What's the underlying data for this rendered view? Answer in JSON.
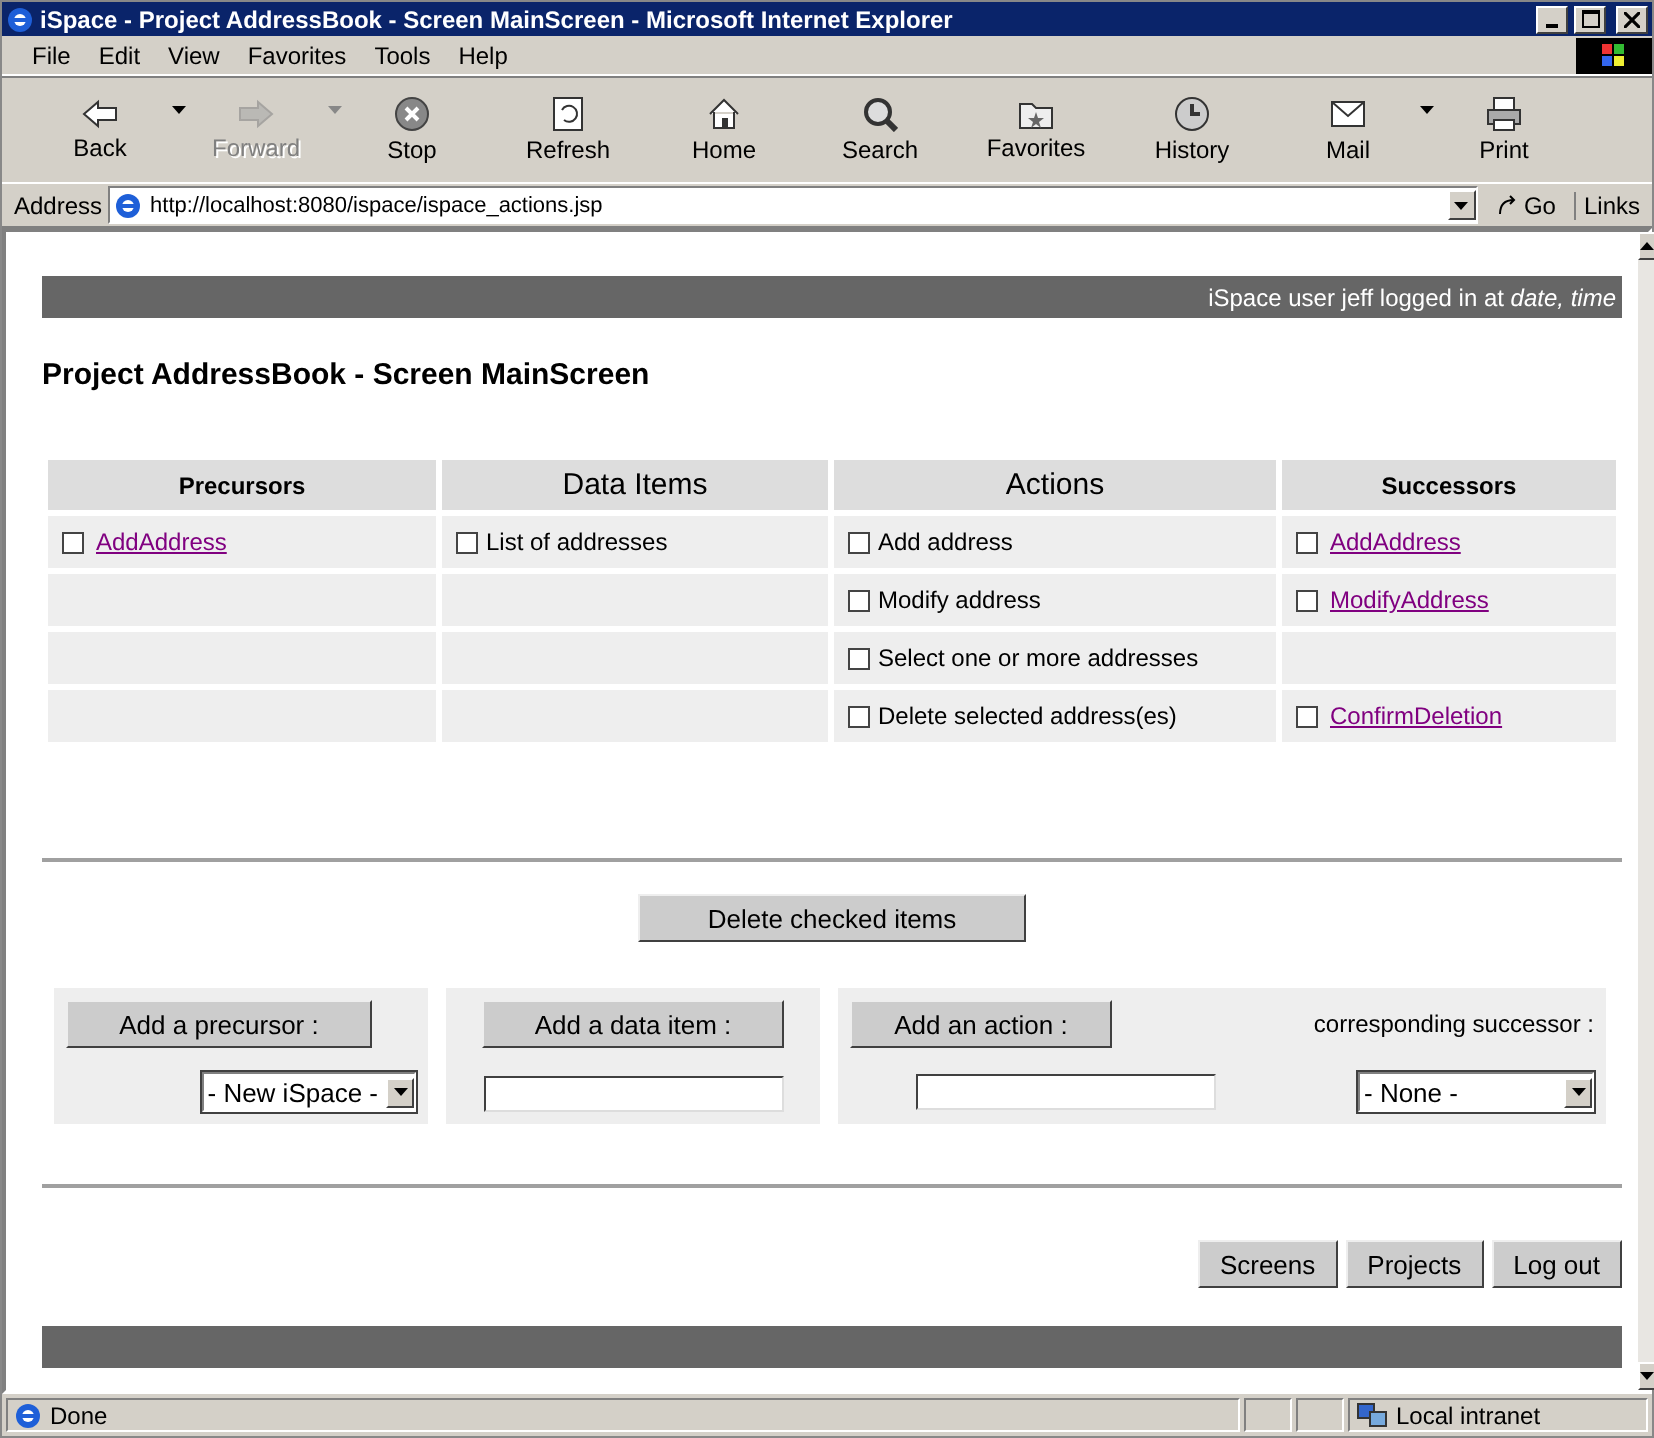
{
  "window": {
    "title": "iSpace - Project AddressBook - Screen MainScreen - Microsoft Internet Explorer"
  },
  "menu": [
    "File",
    "Edit",
    "View",
    "Favorites",
    "Tools",
    "Help"
  ],
  "toolbar": [
    {
      "label": "Back",
      "disabled": false,
      "dropdown": true
    },
    {
      "label": "Forward",
      "disabled": true,
      "dropdown": true
    },
    {
      "label": "Stop",
      "disabled": false,
      "dropdown": false
    },
    {
      "label": "Refresh",
      "disabled": false,
      "dropdown": false
    },
    {
      "label": "Home",
      "disabled": false,
      "dropdown": false
    },
    {
      "label": "Search",
      "disabled": false,
      "dropdown": false
    },
    {
      "label": "Favorites",
      "disabled": false,
      "dropdown": false
    },
    {
      "label": "History",
      "disabled": false,
      "dropdown": false
    },
    {
      "label": "Mail",
      "disabled": false,
      "dropdown": true
    },
    {
      "label": "Print",
      "disabled": false,
      "dropdown": false
    }
  ],
  "address_bar": {
    "label": "Address",
    "url": "http://localhost:8080/ispace/ispace_actions.jsp",
    "go": "Go",
    "links": "Links"
  },
  "page": {
    "banner": "iSpace user jeff logged in at *date, time*",
    "heading": "Project AddressBook - Screen MainScreen",
    "table": {
      "columns": [
        {
          "label": "Precursors",
          "kind": "minor"
        },
        {
          "label": "Data Items",
          "kind": "major"
        },
        {
          "label": "Actions",
          "kind": "major"
        },
        {
          "label": "Successors",
          "kind": "minor"
        }
      ],
      "rows": [
        [
          {
            "kind": "link",
            "text": "AddAddress",
            "checked": false
          },
          {
            "kind": "text",
            "text": "List of addresses",
            "checked": false
          },
          {
            "kind": "text",
            "text": "Add address",
            "checked": false
          },
          {
            "kind": "link",
            "text": "AddAddress",
            "checked": false
          }
        ],
        [
          {
            "kind": "empty"
          },
          {
            "kind": "empty"
          },
          {
            "kind": "text",
            "text": "Modify address",
            "checked": false
          },
          {
            "kind": "link",
            "text": "ModifyAddress",
            "checked": false
          }
        ],
        [
          {
            "kind": "empty"
          },
          {
            "kind": "empty"
          },
          {
            "kind": "text",
            "text": "Select one or more addresses",
            "checked": false
          },
          {
            "kind": "empty"
          }
        ],
        [
          {
            "kind": "empty"
          },
          {
            "kind": "empty"
          },
          {
            "kind": "text",
            "text": "Delete selected address(es)",
            "checked": false
          },
          {
            "kind": "link",
            "text": "ConfirmDeletion",
            "checked": false
          }
        ]
      ]
    },
    "delete_button": "Delete checked items",
    "add_precursor": {
      "button": "Add a precursor :",
      "select": "- New iSpace -"
    },
    "add_data_item": {
      "button": "Add a data item :"
    },
    "add_action": {
      "button": "Add an action :",
      "successor_label": "corresponding successor :",
      "select": "- None -"
    },
    "nav_buttons": [
      "Screens",
      "Projects",
      "Log out"
    ]
  },
  "status_bar": {
    "text": "Done",
    "zone": "Local intranet"
  }
}
